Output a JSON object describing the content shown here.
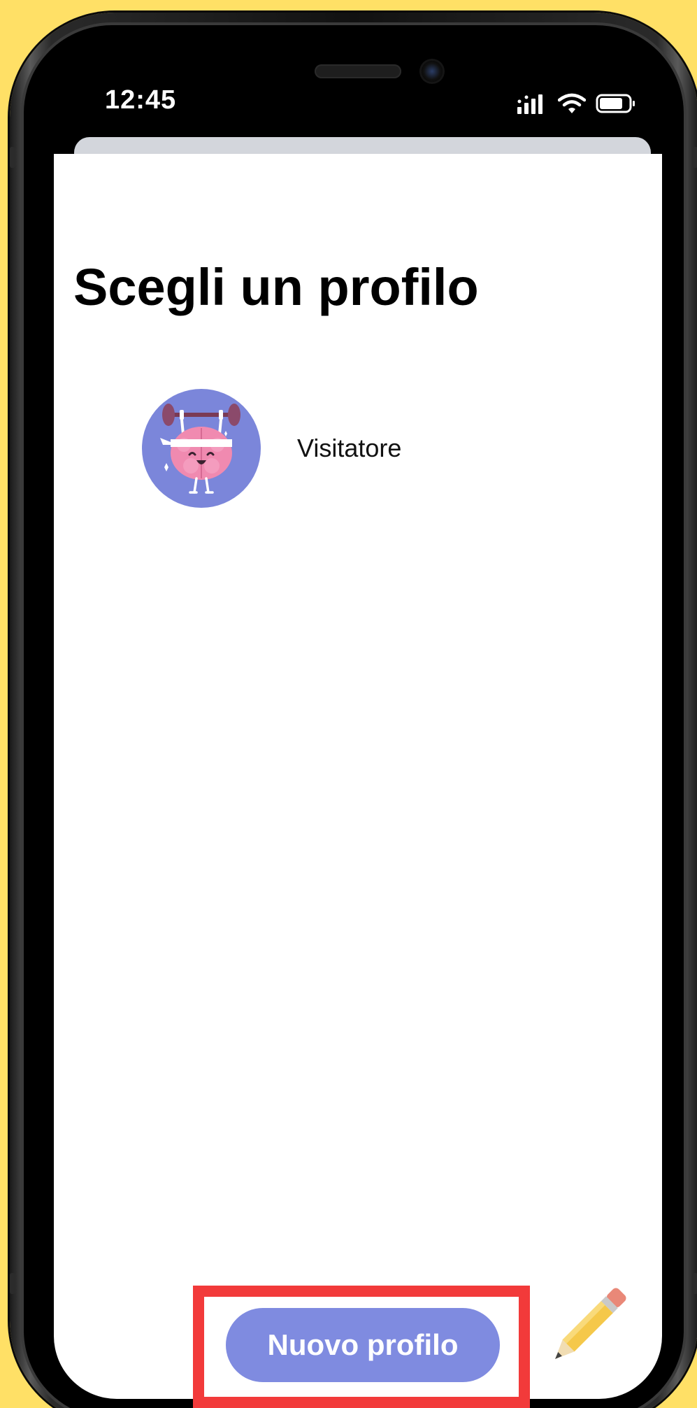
{
  "status_bar": {
    "time": "12:45",
    "signal_icon": "signal-bars-icon",
    "wifi_icon": "wifi-icon",
    "battery_icon": "battery-icon"
  },
  "screen": {
    "title": "Scegli un profilo",
    "profiles": [
      {
        "name": "Visitatore",
        "avatar_icon": "brain-weightlifter-avatar"
      }
    ],
    "new_profile_button": "Nuovo profilo",
    "edit_icon": "pencil-icon"
  },
  "colors": {
    "background": "#FFE066",
    "button": "#7F8BE0",
    "avatar_bg": "#7B86DA",
    "highlight": "#F23A3A"
  }
}
